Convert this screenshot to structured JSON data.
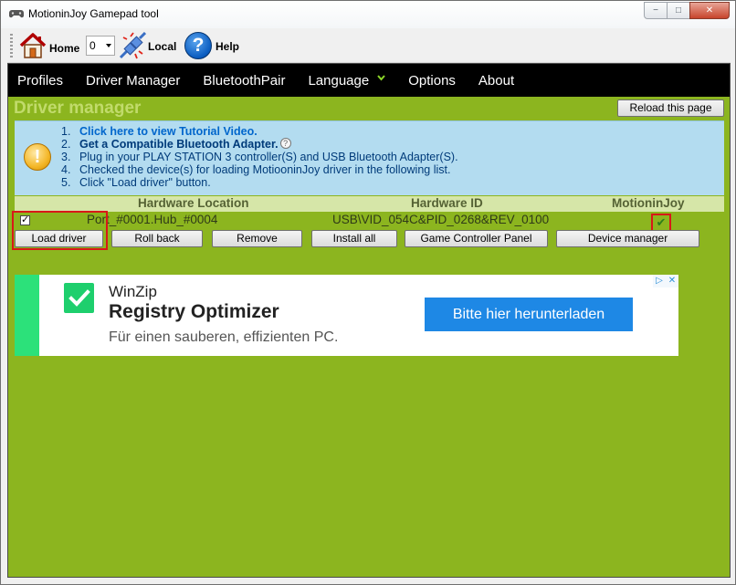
{
  "window": {
    "title": "MotioninJoy Gamepad tool",
    "controls": {
      "minimize": "−",
      "maximize": "□",
      "close": "✕"
    }
  },
  "toolbar": {
    "home_label": "Home",
    "combo_value": "0",
    "local_label": "Local",
    "help_label": "Help",
    "help_glyph": "?"
  },
  "menu": {
    "items": [
      {
        "label": "Profiles"
      },
      {
        "label": "Driver Manager"
      },
      {
        "label": "BluetoothPair"
      },
      {
        "label": "Language"
      },
      {
        "label": "Options"
      },
      {
        "label": "About"
      }
    ]
  },
  "driver_manager": {
    "title": "Driver manager",
    "reload_label": "Reload this page",
    "warn_glyph": "!",
    "steps": [
      {
        "num": "1.",
        "text": "Click here to view Tutorial Video."
      },
      {
        "num": "2.",
        "text": "Get a Compatible Bluetooth Adapter.",
        "help": "?"
      },
      {
        "num": "3.",
        "text": "Plug in your PLAY STATION 3 controller(S) and USB Bluetooth Adapter(S)."
      },
      {
        "num": "4.",
        "text": "Checked the device(s) for loading MotiooninJoy driver in the following list."
      },
      {
        "num": "5.",
        "text": "Click \"Load driver\" button."
      }
    ],
    "table": {
      "headers": {
        "location": "Hardware Location",
        "id": "Hardware ID",
        "motioninjoy": "MotioninJoy"
      },
      "rows": [
        {
          "location": "Port_#0001.Hub_#0004",
          "id": "USB\\VID_054C&PID_0268&REV_0100",
          "status_glyph": "✔"
        }
      ]
    },
    "buttons": {
      "load_driver": "Load driver",
      "roll_back": "Roll back",
      "remove": "Remove",
      "install_all": "Install all",
      "game_controller_panel": "Game Controller Panel",
      "device_manager": "Device manager"
    }
  },
  "ad": {
    "brand": "WinZip",
    "title": "Registry Optimizer",
    "subtitle": "Für einen sauberen, effizienten PC.",
    "cta": "Bitte hier herunterladen",
    "adchoices": "▷",
    "close": "✕"
  },
  "colors": {
    "content_bg": "#8cb51f",
    "menubar_bg": "#000000",
    "info_bg": "#b3dcf0",
    "highlight": "#d81818",
    "ad_cta": "#1e88e5"
  }
}
